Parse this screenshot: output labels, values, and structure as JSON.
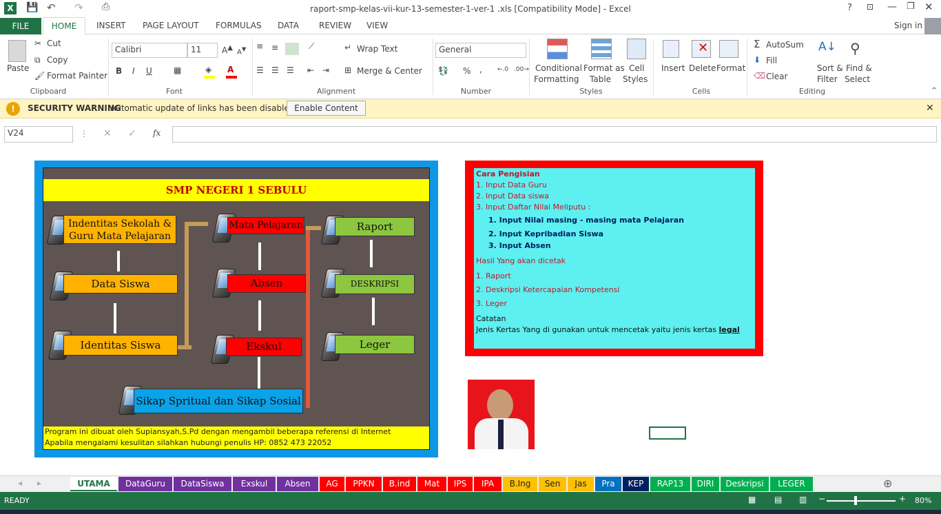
{
  "window": {
    "title": "raport-smp-kelas-vii-kur-13-semester-1-ver-1 .xls  [Compatibility Mode] - Excel",
    "help": "?",
    "signin": "Sign in"
  },
  "tabs": [
    "FILE",
    "HOME",
    "INSERT",
    "PAGE LAYOUT",
    "FORMULAS",
    "DATA",
    "REVIEW",
    "VIEW"
  ],
  "clipboard": {
    "paste": "Paste",
    "cut": "Cut",
    "copy": "Copy",
    "painter": "Format Painter",
    "label": "Clipboard"
  },
  "font": {
    "name": "Calibri",
    "size": "11",
    "label": "Font",
    "bold": "B",
    "italic": "I",
    "underline": "U"
  },
  "alignment": {
    "wrap": "Wrap Text",
    "merge": "Merge & Center",
    "label": "Alignment"
  },
  "number": {
    "format": "General",
    "label": "Number",
    "percent": "%",
    "comma": ","
  },
  "styles": {
    "cond": "Conditional",
    "cond2": "Formatting",
    "fmt": "Format as",
    "fmt2": "Table",
    "cell": "Cell",
    "cell2": "Styles",
    "label": "Styles"
  },
  "cells": {
    "insert": "Insert",
    "delete": "Delete",
    "format": "Format",
    "label": "Cells"
  },
  "editing": {
    "autosum": "AutoSum",
    "fill": "Fill",
    "clear": "Clear",
    "sort": "Sort &",
    "sort2": "Filter",
    "find": "Find &",
    "find2": "Select",
    "label": "Editing"
  },
  "warning": {
    "title": "SECURITY WARNING",
    "msg": "Automatic update of links has been disabled",
    "button": "Enable Content"
  },
  "formula": {
    "namebox": "V24",
    "fx": "fx",
    "value": ""
  },
  "diagram": {
    "school": "SMP NEGERI 1 SEBULU",
    "b1": "Indentitas Sekolah &",
    "b1b": "Guru  Mata Pelajaran",
    "b2": "Data Siswa",
    "b3": "Identitas Siswa",
    "b4": "Mata Pelajaran",
    "b5": "Absen",
    "b6": "Ekskul",
    "b7": "Raport",
    "b8": "DESKRIPSI",
    "b9": "Leger",
    "b10": "Sikap Spritual dan Sikap Sosial",
    "foot1": "Program ini dibuat oleh Supiansyah,S.Pd dengan mengambil beberapa referensi di Internet",
    "foot2": "Apabila mengalami kesulitan silahkan hubungi penulis HP: 0852 473 22052"
  },
  "cara": {
    "title": "Cara Pengisian",
    "l1": "1.  Input  Data Guru",
    "l2": "2.  Input Data siswa",
    "l3": "3.  Input Daftar Nilai Meliputu :",
    "s1": "1.  Input Nilai masing - masing mata Pelajaran",
    "s2": "2.  Input Kepribadian Siswa",
    "s3": "3.  Input Absen",
    "hasil": "Hasil Yang akan dicetak",
    "h1": "1.  Raport",
    "h2": "2. Deskripsi  Ketercapaian Kompetensi",
    "h3": "3.  Leger",
    "catatan": "Catatan",
    "note": "Jenis Kertas Yang di gunakan untuk mencetak yaitu jenis kertas ",
    "legal": "legal"
  },
  "sheets": [
    {
      "name": "UTAMA",
      "color": "#ffffff"
    },
    {
      "name": "DataGuru",
      "color": "#7030a0"
    },
    {
      "name": "DataSiswa",
      "color": "#7030a0"
    },
    {
      "name": "Exskul",
      "color": "#7030a0"
    },
    {
      "name": "Absen",
      "color": "#7030a0"
    },
    {
      "name": "AG",
      "color": "#ff0000"
    },
    {
      "name": "PPKN",
      "color": "#ff0000"
    },
    {
      "name": "B.ind",
      "color": "#ff0000"
    },
    {
      "name": "Mat",
      "color": "#ff0000"
    },
    {
      "name": "IPS",
      "color": "#ff0000"
    },
    {
      "name": "IPA",
      "color": "#ff0000"
    },
    {
      "name": "B.Ing",
      "color": "#ffc000"
    },
    {
      "name": "Sen",
      "color": "#ffc000"
    },
    {
      "name": "Jas",
      "color": "#ffc000"
    },
    {
      "name": "Pra",
      "color": "#0070c0"
    },
    {
      "name": "KEP",
      "color": "#002060"
    },
    {
      "name": "RAP13",
      "color": "#00b050"
    },
    {
      "name": "DIRI",
      "color": "#00b050"
    },
    {
      "name": "Deskripsi",
      "color": "#00b050"
    },
    {
      "name": "LEGER",
      "color": "#00b050"
    }
  ],
  "status": {
    "ready": "READY",
    "zoom": "80%",
    "minus": "−",
    "plus": "+"
  }
}
